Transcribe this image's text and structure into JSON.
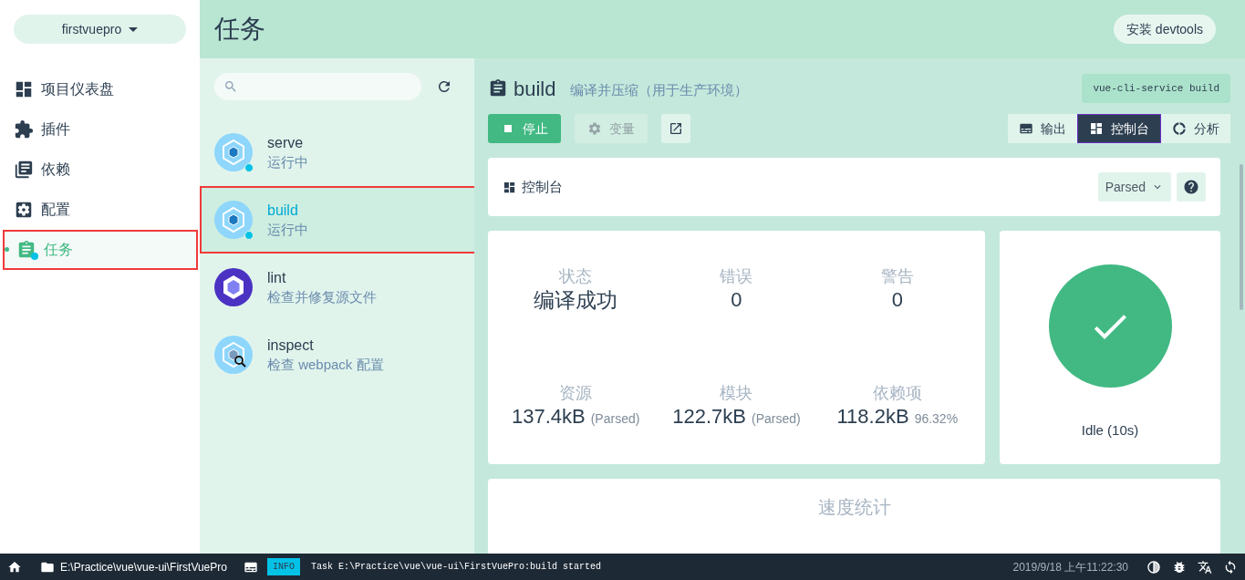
{
  "project_selector": {
    "label": "firstvuepro"
  },
  "nav": [
    {
      "kind": "dashboard",
      "label": "项目仪表盘",
      "selected": false,
      "outlined": false
    },
    {
      "kind": "plugins",
      "label": "插件",
      "selected": false,
      "outlined": false
    },
    {
      "kind": "dependencies",
      "label": "依赖",
      "selected": false,
      "outlined": false
    },
    {
      "kind": "config",
      "label": "配置",
      "selected": false,
      "outlined": false
    },
    {
      "kind": "tasks",
      "label": "任务",
      "selected": true,
      "outlined": true
    }
  ],
  "header": {
    "title": "任务",
    "devtools_button": "安装 devtools"
  },
  "tasks": [
    {
      "kind": "webpack",
      "name": "serve",
      "description": "运行中",
      "running": true,
      "selected": false,
      "outlined": false
    },
    {
      "kind": "webpack",
      "name": "build",
      "description": "运行中",
      "running": true,
      "selected": true,
      "outlined": true
    },
    {
      "kind": "eslint",
      "name": "lint",
      "description": "检查并修复源文件",
      "running": false,
      "selected": false,
      "outlined": false
    },
    {
      "kind": "inspect",
      "name": "inspect",
      "description": "检查 webpack 配置",
      "running": false,
      "selected": false,
      "outlined": false
    }
  ],
  "task_detail": {
    "title": "build",
    "description": "编译并压缩（用于生产环境）",
    "command": "vue-cli-service build",
    "actions": [
      {
        "kind": "stop",
        "label": "停止",
        "disabled": false
      },
      {
        "kind": "variables",
        "label": "变量",
        "disabled": true
      },
      {
        "kind": "open",
        "disabled": false
      }
    ],
    "views": [
      {
        "kind": "output",
        "label": "输出",
        "selected": false
      },
      {
        "kind": "dashboard",
        "label": "控制台",
        "selected": true
      },
      {
        "kind": "analyzer",
        "label": "分析",
        "selected": false
      }
    ]
  },
  "dashboard": {
    "title": "控制台",
    "size_select": "Parsed",
    "stats": [
      {
        "label": "状态",
        "value": "编译成功",
        "kind": "status"
      },
      {
        "label": "错误",
        "value": "0",
        "kind": "count"
      },
      {
        "label": "警告",
        "value": "0",
        "kind": "count"
      },
      {
        "label": "资源",
        "value": "137.4kB",
        "note": "(Parsed)",
        "kind": "size"
      },
      {
        "label": "模块",
        "value": "122.7kB",
        "note": "(Parsed)",
        "kind": "size"
      },
      {
        "label": "依赖项",
        "value": "118.2kB",
        "note": "96.32%",
        "kind": "size"
      }
    ],
    "status": {
      "kind": "success",
      "label": "Idle (10s)"
    },
    "speed_title": "速度统计"
  },
  "status_bar": {
    "path": "E:\\Practice\\vue\\vue-ui\\FirstVuePro",
    "log_level": "INFO",
    "log_message": "Task E:\\Practice\\vue\\vue-ui\\FirstVuePro:build started",
    "time": "2019/9/18 上午11:22:30"
  }
}
